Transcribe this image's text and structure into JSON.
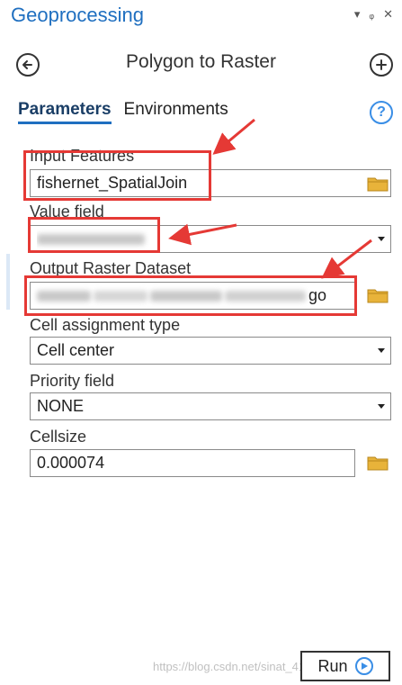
{
  "pane": {
    "title": "Geoprocessing",
    "controls": [
      "▾",
      "ᵩ",
      "✕"
    ]
  },
  "tool": {
    "title": "Polygon to Raster"
  },
  "tabs": [
    {
      "label": "Parameters",
      "active": true
    },
    {
      "label": "Environments",
      "active": false
    }
  ],
  "help_glyph": "?",
  "params": {
    "input_features": {
      "label": "Input Features",
      "value": "fishernet_SpatialJoin"
    },
    "value_field": {
      "label": "Value field",
      "value": ""
    },
    "output_raster": {
      "label": "Output Raster Dataset",
      "value_prefix": "",
      "value_suffix": "go"
    },
    "cell_assignment": {
      "label": "Cell assignment type",
      "value": "Cell center"
    },
    "priority_field": {
      "label": "Priority field",
      "value": "NONE"
    },
    "cellsize": {
      "label": "Cellsize",
      "value": "0.000074"
    }
  },
  "run": {
    "label": "Run"
  },
  "watermark": "https://blog.csdn.net/sinat_4156...",
  "colors": {
    "accent": "#1f6fc0",
    "annotation": "#e53935",
    "help": "#3a8ee6",
    "folder": "#e8b33a"
  }
}
